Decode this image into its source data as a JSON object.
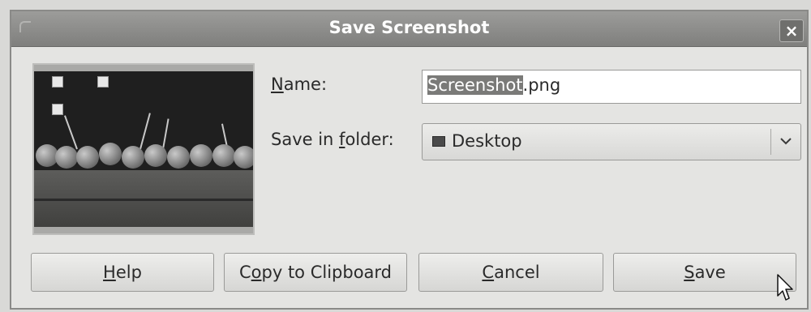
{
  "window": {
    "title": "Save Screenshot",
    "close_glyph": "×"
  },
  "form": {
    "name_label_mnemonic": "N",
    "name_label_rest": "ame:",
    "name_value_selected": "Screenshot",
    "name_value_ext": ".png",
    "folder_label_pre": "Save in ",
    "folder_label_mnemonic": "f",
    "folder_label_post": "older:",
    "folder_value": "Desktop",
    "folder_icon": "desktop-icon"
  },
  "buttons": {
    "help_mnemonic": "H",
    "help_rest": "elp",
    "copy_pre": "C",
    "copy_mnemonic": "o",
    "copy_rest": "py to Clipboard",
    "cancel_mnemonic": "C",
    "cancel_rest": "ancel",
    "save_mnemonic": "S",
    "save_rest": "ave"
  },
  "icons": [
    "close-icon",
    "desktop-icon",
    "chevron-down-icon",
    "mouse-pointer-icon"
  ]
}
